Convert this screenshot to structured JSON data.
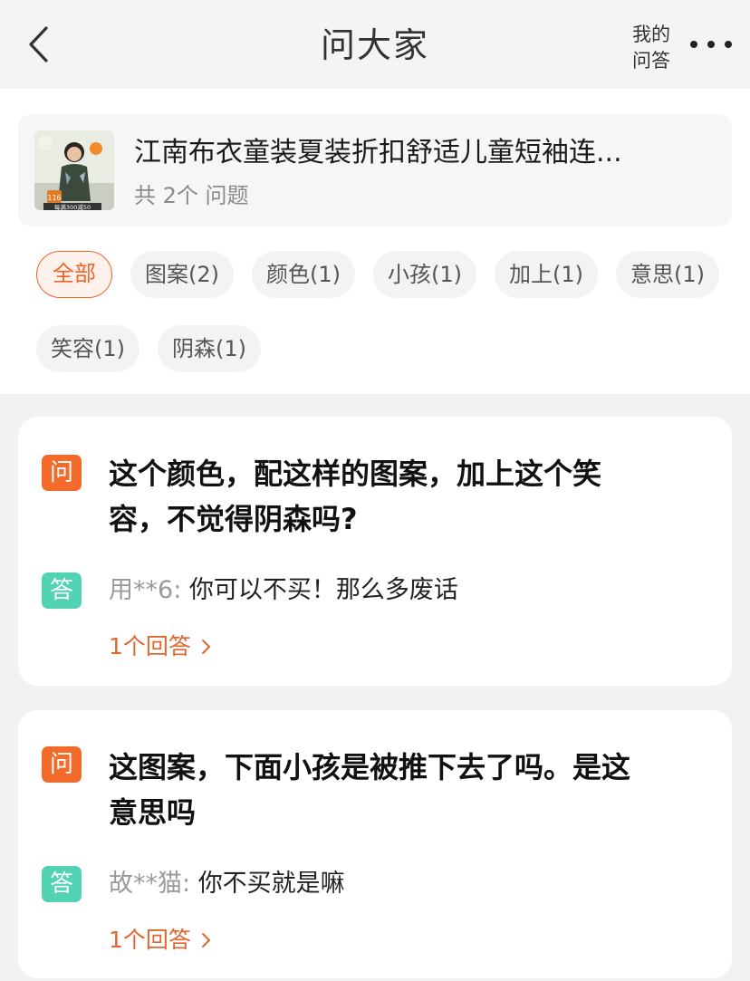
{
  "header": {
    "title": "问大家",
    "my_qa_line1": "我的",
    "my_qa_line2": "问答"
  },
  "product": {
    "title": "江南布衣童装夏装折扣舒适儿童短袖连...",
    "count_text": "共 2个 问题",
    "thumb_price": "116",
    "thumb_promo": "每满300减50"
  },
  "tags": [
    "全部",
    "图案(2)",
    "颜色(1)",
    "小孩(1)",
    "加上(1)",
    "意思(1)",
    "笑容(1)",
    "阴森(1)"
  ],
  "badges": {
    "question": "问",
    "answer": "答"
  },
  "questions": [
    {
      "question_line1": "这个颜色，配这样的图案，加上这个笑",
      "question_line2": "容，不觉得阴森吗?",
      "answer_user": "用**6",
      "answer_text": "你可以不买！那么多废话",
      "reply_count": "1个回答"
    },
    {
      "question_line1": "这图案，下面小孩是被推下去了吗。是这",
      "question_line2": "意思吗",
      "answer_user": "故**猫",
      "answer_text": "你不买就是嘛",
      "reply_count": "1个回答"
    }
  ],
  "colors": {
    "accent": "#f0642a",
    "question_badge": "#f36b2b",
    "answer_badge": "#52d3b3"
  }
}
